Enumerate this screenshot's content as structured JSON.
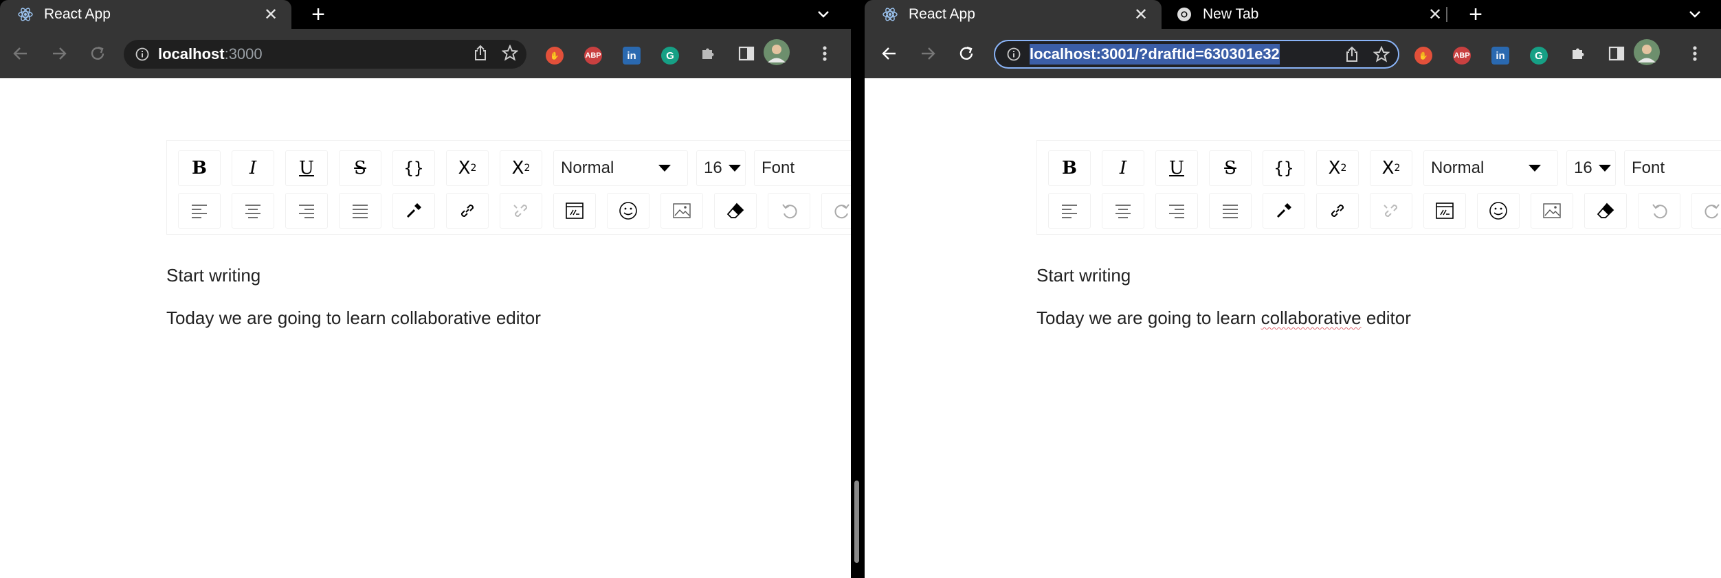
{
  "left_window": {
    "tabs": [
      {
        "title": "React App",
        "close": "✕",
        "favicon": "react-icon",
        "active": true
      }
    ],
    "new_tab": "+",
    "address": {
      "host": "localhost",
      "rest": ":3000"
    },
    "editor": {
      "block_type": "Normal",
      "font_size": "16",
      "font_family": "Font",
      "lines": [
        "Start writing",
        "Today we are going to learn collaborative editor"
      ]
    }
  },
  "right_window": {
    "tabs": [
      {
        "title": "React App",
        "close": "✕",
        "favicon": "react-icon",
        "active": true
      },
      {
        "title": "New Tab",
        "close": "✕",
        "favicon": "chrome-icon",
        "active": false
      }
    ],
    "new_tab": "+",
    "address": {
      "url": "localhost:3001/?draftId=630301e32"
    },
    "editor": {
      "block_type": "Normal",
      "font_size": "16",
      "font_family": "Font",
      "line1": "Start writing",
      "line2_before": "Today we are going to learn ",
      "line2_misspelled": "collaborative",
      "line2_after": " editor"
    }
  },
  "editor_toolbar": {
    "bold": "B",
    "italic": "I",
    "underline": "U",
    "strikethrough": "S",
    "code": "{}",
    "superscript_base": "X",
    "superscript": "2",
    "subscript_base": "X",
    "subscript": "2"
  },
  "extensions": [
    "ABP",
    "in",
    "G"
  ],
  "colors": {
    "tabstrip": "#000000",
    "toolbar": "#353535",
    "omnibox_focus": "#8ab4f8",
    "selection": "#3b5ea7"
  }
}
